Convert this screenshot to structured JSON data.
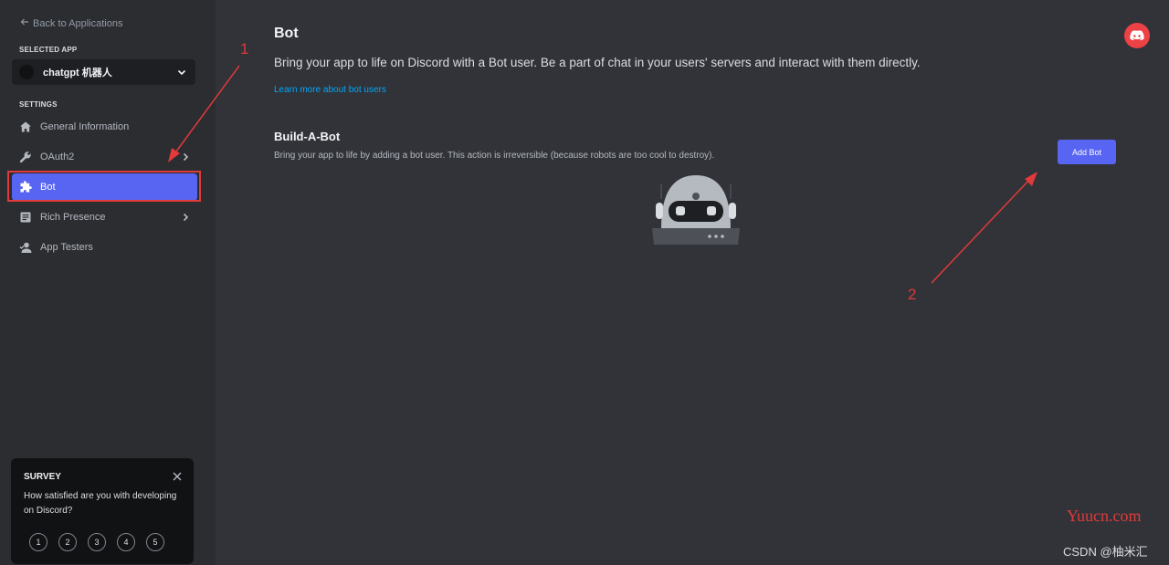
{
  "sidebar": {
    "back_label": "Back to Applications",
    "selected_app_label": "SELECTED APP",
    "app_name": "chatgpt 机器人",
    "settings_label": "SETTINGS",
    "items": [
      {
        "label": "General Information",
        "icon": "home-icon"
      },
      {
        "label": "OAuth2",
        "icon": "wrench-icon"
      },
      {
        "label": "Bot",
        "icon": "puzzle-icon",
        "active": true
      },
      {
        "label": "Rich Presence",
        "icon": "document-icon"
      },
      {
        "label": "App Testers",
        "icon": "user-icon"
      }
    ]
  },
  "survey": {
    "title": "SURVEY",
    "question": "How satisfied are you with developing on Discord?",
    "ratings": [
      "1",
      "2",
      "3",
      "4",
      "5"
    ]
  },
  "main": {
    "title": "Bot",
    "description": "Bring your app to life on Discord with a Bot user. Be a part of chat in your users' servers and interact with them directly.",
    "learn_more": "Learn more about bot users",
    "build_title": "Build-A-Bot",
    "build_description": "Bring your app to life by adding a bot user. This action is irreversible (because robots are too cool to destroy).",
    "add_bot_label": "Add Bot"
  },
  "annotations": {
    "marker_1": "1",
    "marker_2": "2",
    "color": "#e03a3a"
  },
  "watermarks": {
    "site": "Yuucn.com",
    "csdn": "CSDN @柚米汇"
  },
  "colors": {
    "accent": "#5865f2",
    "link": "#00a8fc",
    "discord_red": "#ed4245"
  }
}
